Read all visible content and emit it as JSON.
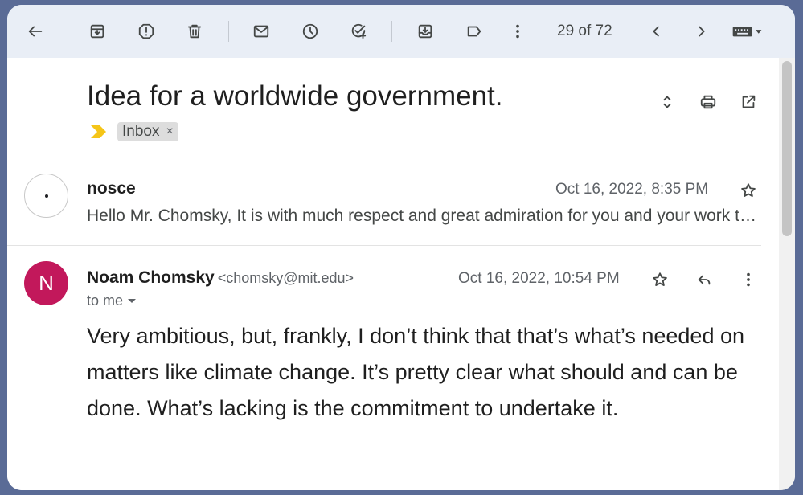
{
  "toolbar": {
    "icons": [
      "back-arrow-icon",
      "archive-icon",
      "report-spam-icon",
      "delete-icon",
      "mark-unread-icon",
      "snooze-icon",
      "add-to-tasks-icon",
      "move-to-icon",
      "label-icon",
      "more-vert-icon",
      "newer-chevron-icon",
      "older-chevron-icon",
      "keyboard-icon"
    ],
    "counter": "29 of 72"
  },
  "header": {
    "subject": "Idea for a worldwide government.",
    "label_chip": "Inbox",
    "chip_close": "×"
  },
  "messages": [
    {
      "avatar_letter": "",
      "sender_name": "nosce",
      "date": "Oct 16, 2022, 8:35 PM",
      "snippet": "Hello Mr. Chomsky, It is with much respect and great admiration for you and your work that I write to you."
    },
    {
      "avatar_letter": "N",
      "avatar_color": "#c2185b",
      "sender_name": "Noam Chomsky",
      "sender_email": "<chomsky@mit.edu>",
      "date": "Oct 16, 2022, 10:54 PM",
      "recipient": "to me",
      "body": "Very ambitious, but, frankly, I don’t think that that’s what’s needed on matters like climate change.  It’s pretty clear what should and can be done.  What’s lacking is the commitment to undertake it."
    }
  ],
  "colors": {
    "toolbar_bg": "#e9eef6",
    "page_bg": "#5a6b96",
    "importance_marker": "#f5c518"
  }
}
